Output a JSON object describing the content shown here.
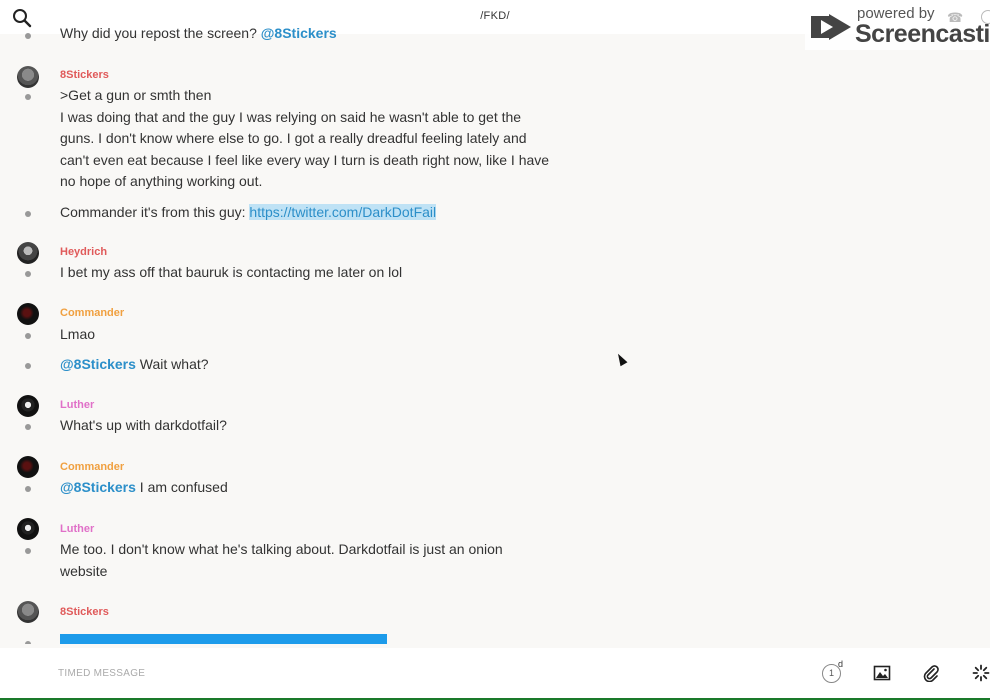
{
  "header": {
    "room_name": "/FKD/"
  },
  "watermark": {
    "powered_by": "powered by",
    "brand": "Screencastify"
  },
  "messages": [
    {
      "author": "",
      "text": "Why did you repost the screen?",
      "mention": "@8Stickers"
    },
    {
      "author": "8Stickers",
      "author_color": "#e05a5a",
      "lines": [
        ">Get a gun or smth then",
        "I was doing that and the guy I was relying on said he wasn't able to get the",
        "guns. I don't know where else to go. I got a really dreadful feeling lately and",
        "can't even eat because I feel like every way I turn is death right now, like I have",
        "no hope of anything working out."
      ]
    },
    {
      "author": "",
      "text": "Commander it's from this guy: ",
      "link": "https://twitter.com/DarkDotFail"
    },
    {
      "author": "Heydrich",
      "author_color": "#e05a5a",
      "text": "I bet my ass off that bauruk is contacting me later on lol"
    },
    {
      "author": "Commander",
      "author_color": "#f0a040",
      "text": "Lmao"
    },
    {
      "author": "",
      "mention": "@8Stickers",
      "text": " Wait what?"
    },
    {
      "author": "Luther",
      "author_color": "#e070c8",
      "text": "What's up with darkdotfail?"
    },
    {
      "author": "Commander",
      "author_color": "#f0a040",
      "mention": "@8Stickers",
      "text": " I am confused"
    },
    {
      "author": "Luther",
      "author_color": "#e070c8",
      "lines": [
        "Me too. I don't know what he's talking about. Darkdotfail is just an onion",
        "website"
      ]
    },
    {
      "author": "8Stickers",
      "author_color": "#e05a5a",
      "typing_progress": 0.5
    }
  ],
  "composer": {
    "placeholder": "TIMED MESSAGE",
    "timer_value": "1",
    "timer_unit": "d"
  },
  "icons": {
    "search": "search-icon",
    "image": "image-icon",
    "attach": "paperclip-icon",
    "settings": "spinner-icon"
  },
  "colors": {
    "accent": "#2c8fc9",
    "red_user": "#e05a5a",
    "orange_user": "#f0a040",
    "pink_user": "#e070c8"
  }
}
